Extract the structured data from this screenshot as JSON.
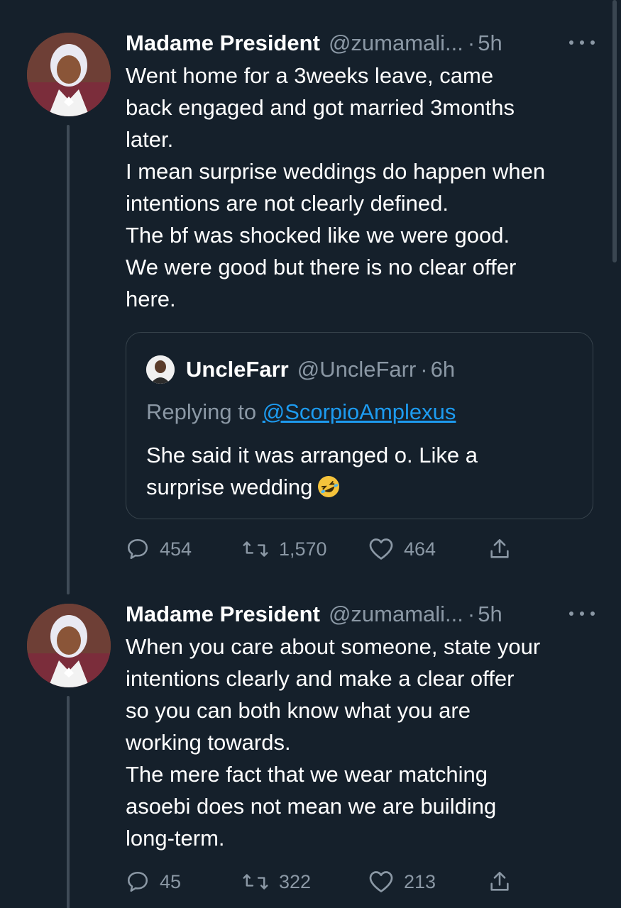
{
  "tweets": [
    {
      "name": "Madame President",
      "handle": "@zumamali...",
      "dot": "·",
      "time": "5h",
      "lines": [
        "Went home for a 3weeks leave, came",
        "back engaged and got married 3months",
        "later.",
        "I mean surprise weddings do happen when",
        "intentions are not clearly defined.",
        "The bf was shocked like we were good.",
        "We were good but there is no clear offer",
        "here."
      ],
      "quote": {
        "name": "UncleFarr",
        "handle": "@UncleFarr",
        "dot": "·",
        "time": "6h",
        "replying_prefix": "Replying to ",
        "replying_mention": "@ScorpioAmplexus",
        "line1": "She said it was arranged o. Like a",
        "line2": "surprise wedding",
        "emoji": "rolling-on-floor-laughing-emoji"
      },
      "replies": "454",
      "retweets": "1,570",
      "likes": "464"
    },
    {
      "name": "Madame President",
      "handle": "@zumamali...",
      "dot": "·",
      "time": "5h",
      "lines": [
        "When you care about someone, state your",
        "intentions clearly and make a clear offer",
        "so you can both know what you are",
        "working towards.",
        "The mere fact that we wear matching",
        "asoebi does not mean we are building",
        "long-term."
      ],
      "replies": "45",
      "retweets": "322",
      "likes": "213"
    }
  ],
  "icons": {
    "reply": "reply-icon",
    "retweet": "retweet-icon",
    "like": "heart-icon",
    "share": "share-icon",
    "more": "more-options-icon"
  },
  "colors": {
    "background": "#15202b",
    "text": "#ffffff",
    "secondary": "#8b98a5",
    "link": "#1d9bf0"
  }
}
